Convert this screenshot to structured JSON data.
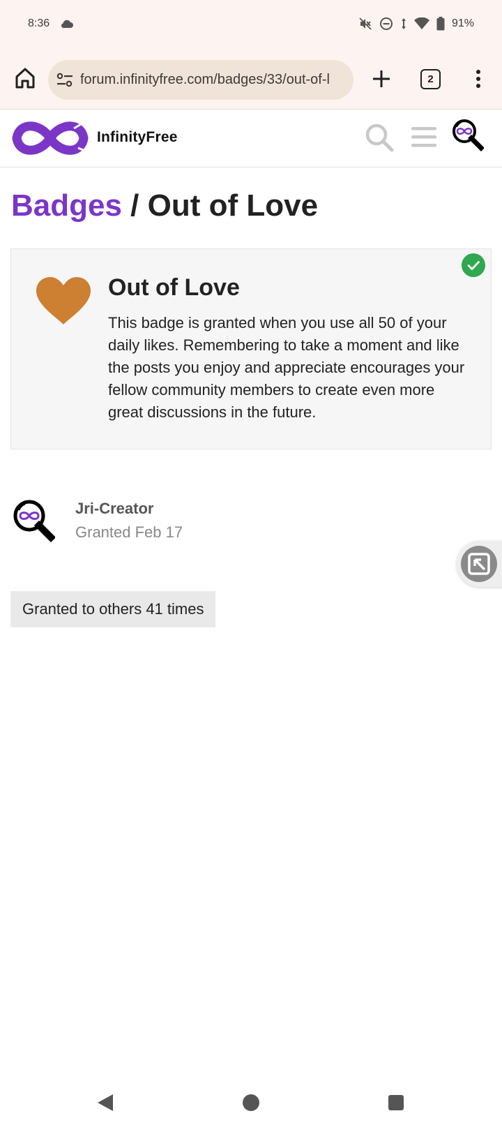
{
  "status_bar": {
    "time": "8:36",
    "battery": "91%",
    "icons": [
      "cloud-icon",
      "mute-icon",
      "dnd-icon",
      "data-arrows-icon",
      "wifi-icon",
      "battery-icon"
    ]
  },
  "browser": {
    "url": "forum.infinityfree.com/badges/33/out-of-l",
    "tab_count": "2",
    "icons": [
      "home-icon",
      "tune-icon",
      "plus-icon",
      "more-vert-icon"
    ]
  },
  "site": {
    "name": "InfinityFree",
    "icons": [
      "infinity-logo-icon",
      "search-icon",
      "hamburger-menu-icon",
      "user-avatar-icon"
    ],
    "colors": {
      "brand": "#7b36c8",
      "heart": "#cd7f32",
      "check": "#2fa84f"
    }
  },
  "page": {
    "breadcrumb": "Badges",
    "separator": " / ",
    "title": "Out of Love"
  },
  "badge": {
    "name": "Out of Love",
    "description": "This badge is granted when you use all 50 of your daily likes. Remembering to take a moment and like the posts you enjoy and appreciate encourages your fellow community members to create even more great discussions in the future.",
    "icon": "heart-icon",
    "granted_icon": "check-circle-icon"
  },
  "granted": {
    "user_name": "Jri-Creator",
    "date": "Granted Feb 17"
  },
  "others": {
    "label": "Granted to others 41 times"
  },
  "nav_bar": {
    "icons": [
      "back-icon",
      "home-circle-icon",
      "recents-icon"
    ]
  }
}
